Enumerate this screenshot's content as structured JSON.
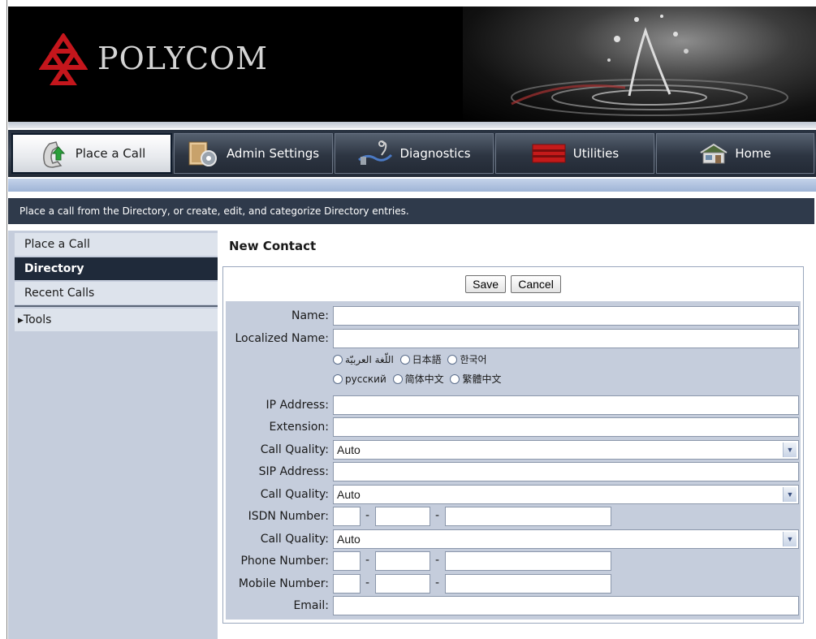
{
  "brand": {
    "logo_text": "POLYCOM"
  },
  "nav": {
    "tabs": [
      {
        "label": "Place a Call",
        "icon": "phone-icon",
        "active": true
      },
      {
        "label": "Admin Settings",
        "icon": "admin-settings-icon",
        "active": false
      },
      {
        "label": "Diagnostics",
        "icon": "diagnostics-icon",
        "active": false
      },
      {
        "label": "Utilities",
        "icon": "utilities-icon",
        "active": false
      },
      {
        "label": "Home",
        "icon": "home-icon",
        "active": false
      }
    ]
  },
  "info_bar": {
    "text": "Place a call from the Directory, or create, edit, and categorize Directory entries."
  },
  "sidebar": {
    "items": [
      {
        "label": "Place a Call",
        "active": false
      },
      {
        "label": "Directory",
        "active": true
      },
      {
        "label": "Recent Calls",
        "active": false
      }
    ],
    "tools": {
      "label": "Tools",
      "icon": "triangle-right-icon"
    }
  },
  "main": {
    "title": "New Contact",
    "buttons": {
      "save": "Save",
      "cancel": "Cancel"
    },
    "fields": {
      "name": "Name:",
      "localized_name": "Localized Name:",
      "ip_address": "IP Address:",
      "extension": "Extension:",
      "call_quality_1": "Call Quality:",
      "sip_address": "SIP Address:",
      "call_quality_2": "Call Quality:",
      "isdn_number": "ISDN Number:",
      "call_quality_3": "Call Quality:",
      "phone_number": "Phone Number:",
      "mobile_number": "Mobile Number:",
      "email": "Email:"
    },
    "call_quality_values": [
      "Auto",
      "Auto",
      "Auto"
    ],
    "separator": "-",
    "languages": {
      "row1": [
        "اللّغة العربيّة",
        "日本語",
        "한국어"
      ],
      "row2": [
        "русский",
        "简体中文",
        "繁體中文"
      ]
    }
  },
  "colors": {
    "banner_bg": "#000000",
    "nav_bg": "#2d3542",
    "info_bar_bg": "#2f3a4b",
    "sidebar_bg": "#c5cddc",
    "active_sidebar_bg": "#1f2a3a",
    "logo_red": "#c4161c"
  }
}
